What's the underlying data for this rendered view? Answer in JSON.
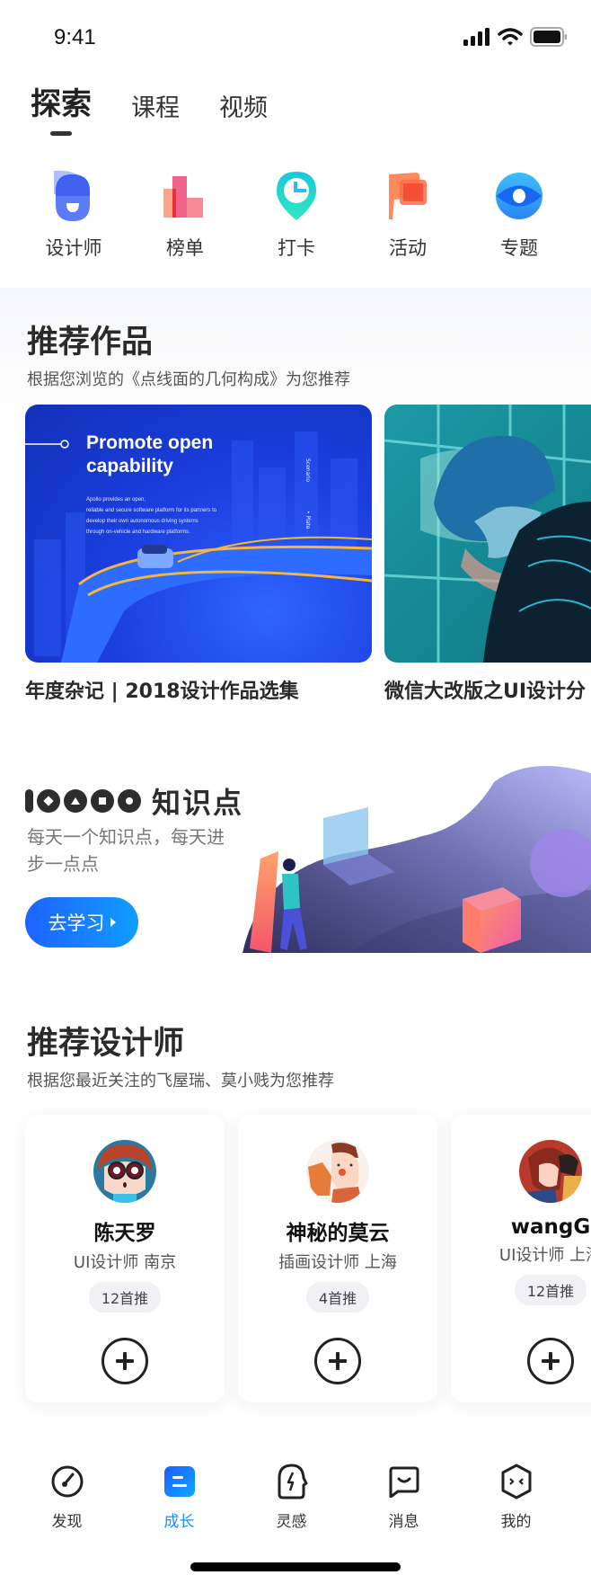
{
  "status_bar": {
    "time": "9:41"
  },
  "top_tabs": [
    {
      "label": "探索",
      "active": true
    },
    {
      "label": "课程",
      "active": false
    },
    {
      "label": "视频",
      "active": false
    }
  ],
  "quick_entries": [
    {
      "label": "设计师",
      "icon": "designer-icon"
    },
    {
      "label": "榜单",
      "icon": "ranking-icon"
    },
    {
      "label": "打卡",
      "icon": "checkin-icon"
    },
    {
      "label": "活动",
      "icon": "event-flag-icon"
    },
    {
      "label": "专题",
      "icon": "topic-eye-icon"
    }
  ],
  "recommended_works": {
    "title": "推荐作品",
    "subtitle": "根据您浏览的《点线面的几何构成》为您推荐",
    "items": [
      {
        "title": "年度杂记 | 2018设计作品选集",
        "thumb": {
          "heading": "Promote open capability",
          "body": [
            "Apollo provides an open,",
            "reliable and secure software platform for its partners to",
            "develop their own autonomous driving systems",
            "through on-vehicle and hardware platforms."
          ],
          "side_labels": [
            "Scenario",
            "• Plate"
          ]
        }
      },
      {
        "title": "微信大改版之UI设计分",
        "thumb": {}
      }
    ]
  },
  "banner": {
    "logo_text": "知识点",
    "description": "每天一个知识点，每天进步一点点",
    "button_label": "去学习"
  },
  "recommended_designers": {
    "title": "推荐设计师",
    "subtitle": "根据您最近关注的飞屋瑞、莫小贱为您推荐",
    "items": [
      {
        "name": "陈天罗",
        "role": "UI设计师 南京",
        "badge": "12首推"
      },
      {
        "name": "神秘的莫云",
        "role": "插画设计师 上海",
        "badge": "4首推"
      },
      {
        "name": "wangG",
        "role": "UI设计师 上海",
        "badge": "12首推"
      }
    ]
  },
  "bottom_nav": [
    {
      "label": "发现",
      "icon": "compass-gauge-icon",
      "active": false
    },
    {
      "label": "成长",
      "icon": "growth-icon",
      "active": true
    },
    {
      "label": "灵感",
      "icon": "inspiration-head-icon",
      "active": false
    },
    {
      "label": "消息",
      "icon": "message-icon",
      "active": false
    },
    {
      "label": "我的",
      "icon": "profile-face-icon",
      "active": false
    }
  ],
  "colors": {
    "accent": "#1a8cff",
    "button_gradient_start": "#1d63ff",
    "button_gradient_end": "#119dff"
  }
}
